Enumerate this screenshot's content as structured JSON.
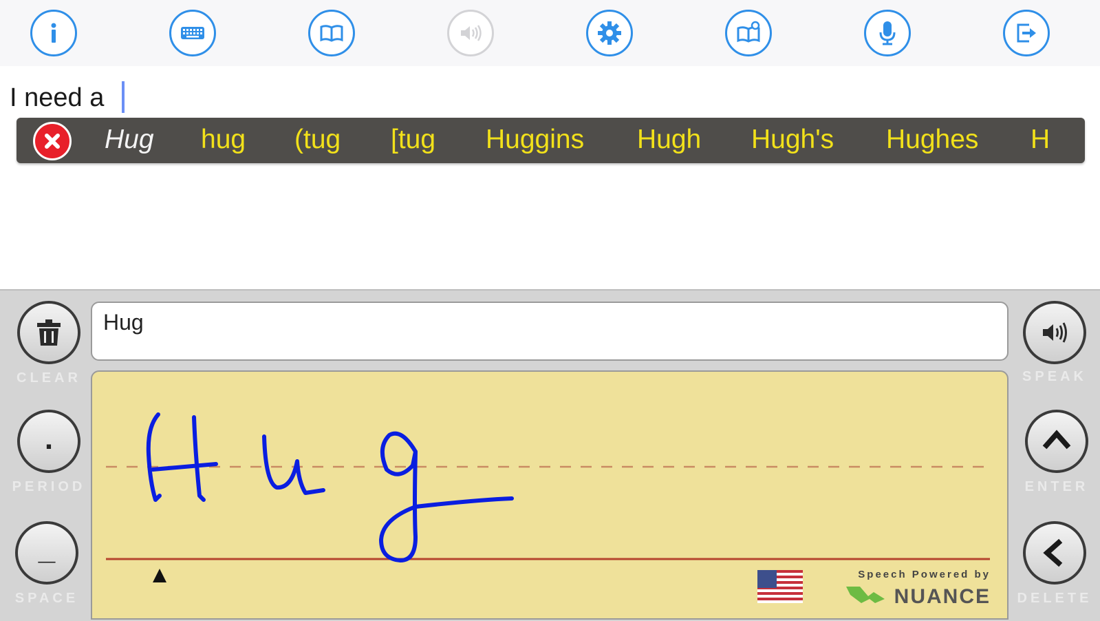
{
  "toolbar": {
    "buttons": [
      {
        "name": "info",
        "icon": "info-icon"
      },
      {
        "name": "keyboard",
        "icon": "keyboard-icon"
      },
      {
        "name": "dictionary",
        "icon": "book-icon"
      },
      {
        "name": "speak",
        "icon": "speaker-icon",
        "disabled": true
      },
      {
        "name": "settings",
        "icon": "gear-icon"
      },
      {
        "name": "word-bank",
        "icon": "book-search-icon"
      },
      {
        "name": "dictation",
        "icon": "microphone-icon"
      },
      {
        "name": "share",
        "icon": "export-icon"
      }
    ],
    "accent_color": "#2f8fe8"
  },
  "document": {
    "text": "I need a"
  },
  "suggestions": {
    "items": [
      "Hug",
      "hug",
      "(tug",
      "[tug",
      "Huggins",
      "Hugh",
      "Hugh's",
      "Hughes",
      "H"
    ],
    "text_color": "#f2e11a",
    "bar_color": "#4f4d4a"
  },
  "panel": {
    "recognized_text": "Hug",
    "buttons": {
      "clear": "CLEAR",
      "period": "PERIOD",
      "space": "SPACE",
      "speak": "SPEAK",
      "enter": "ENTER",
      "delete": "DELETE"
    },
    "period_glyph": ".",
    "space_glyph": "_",
    "ink_color": "#0a1ee0",
    "pad_color": "#efe19a",
    "credit": {
      "line1": "Speech Powered by",
      "brand": "NUANCE"
    },
    "language_flag": "flag-us-icon"
  }
}
